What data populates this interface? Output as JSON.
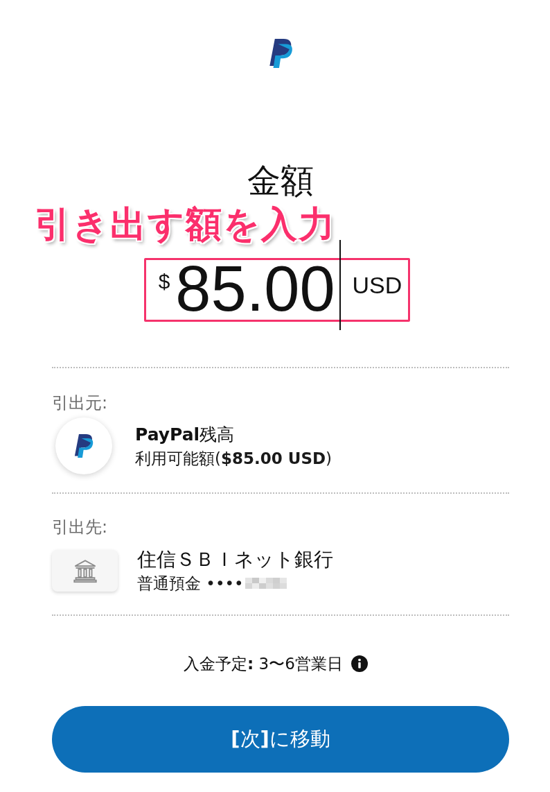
{
  "heading": "金額",
  "annotation": {
    "text": "引き出す額を入力"
  },
  "amount": {
    "currency_symbol": "$",
    "value": "85.00",
    "currency": "USD"
  },
  "accounts": [
    {
      "kind": "balance",
      "label": "引出元:",
      "title": "**PayPal**残高",
      "subtitle": "利用可能額(**$85.00 USD**)"
    },
    {
      "kind": "bank",
      "label": "引出先:",
      "title": "住信ＳＢＩネット銀行",
      "subtitle": "普通預金 ••••",
      "redacted": true
    }
  ],
  "arrival": "入金予定**:** 3〜6営業日",
  "next_button": "**[**次**]**に移動"
}
